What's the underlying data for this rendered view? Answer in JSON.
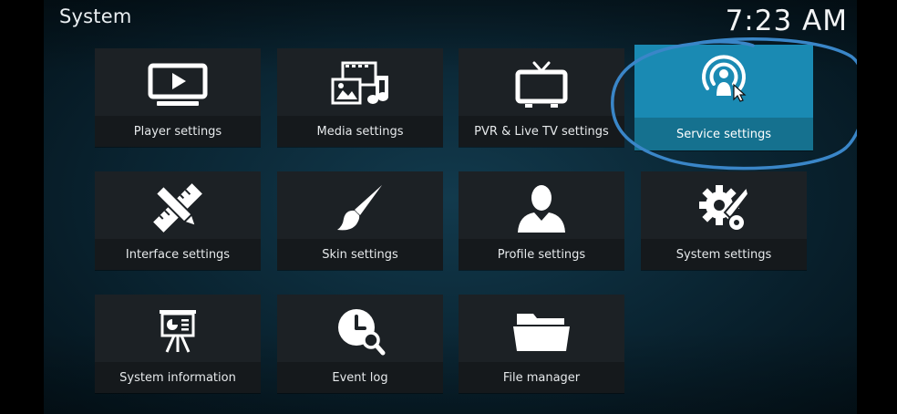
{
  "header": {
    "title": "System",
    "clock": "7:23 AM"
  },
  "tiles": [
    {
      "label": "Player settings",
      "icon": "tv-play-icon"
    },
    {
      "label": "Media settings",
      "icon": "media-icon"
    },
    {
      "label": "PVR & Live TV settings",
      "icon": "live-tv-icon"
    },
    {
      "label": "Service settings",
      "icon": "broadcast-user-icon",
      "focused": true
    },
    {
      "label": "Interface settings",
      "icon": "pencil-ruler-icon"
    },
    {
      "label": "Skin settings",
      "icon": "paintbrush-icon"
    },
    {
      "label": "Profile settings",
      "icon": "user-profile-icon"
    },
    {
      "label": "System settings",
      "icon": "gears-wrench-icon"
    },
    {
      "label": "System information",
      "icon": "presentation-board-icon"
    },
    {
      "label": "Event log",
      "icon": "clock-search-icon"
    },
    {
      "label": "File manager",
      "icon": "folder-icon"
    }
  ],
  "colors": {
    "focus": "#1a8ab3",
    "annotation": "#3a86c8"
  }
}
